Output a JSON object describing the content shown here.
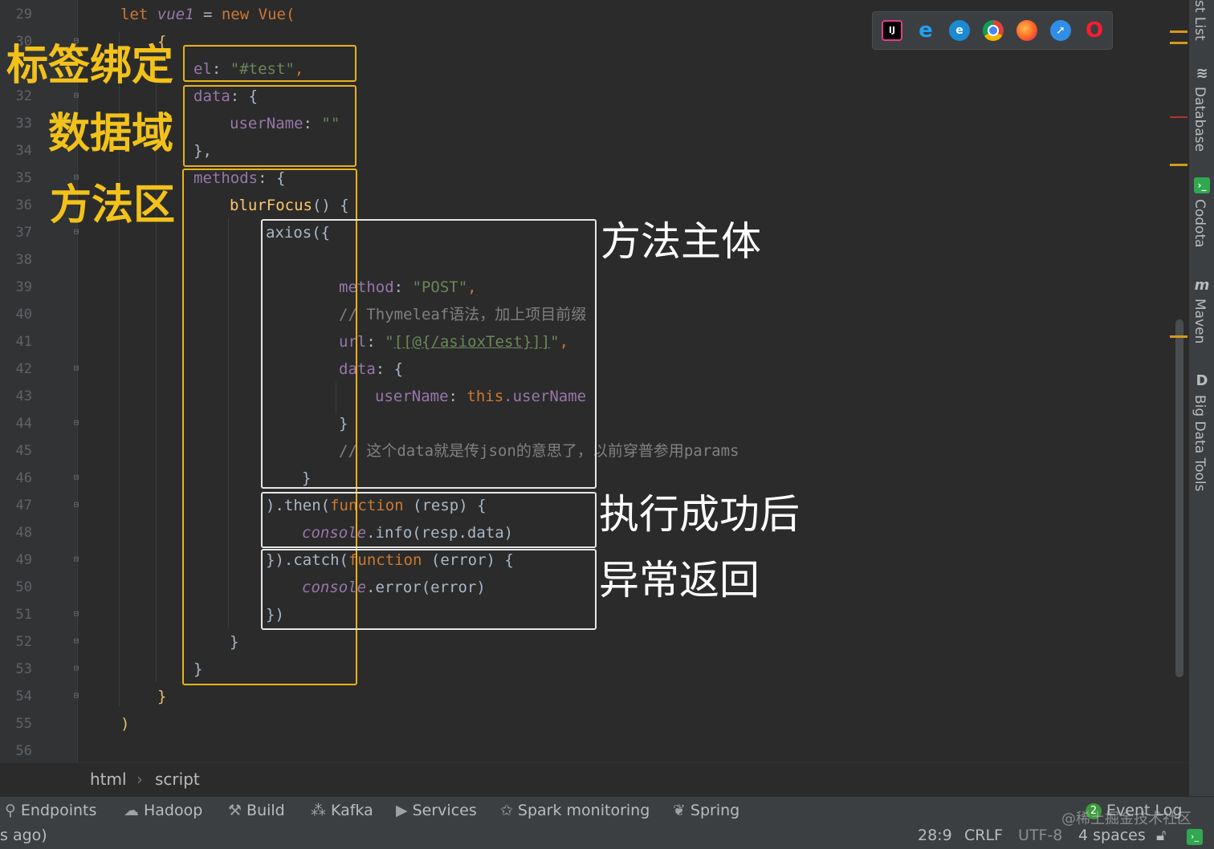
{
  "editor": {
    "line_numbers": [
      "29",
      "30",
      "32",
      "33",
      "34",
      "35",
      "36",
      "37",
      "38",
      "39",
      "40",
      "41",
      "42",
      "43",
      "44",
      "45",
      "46",
      "47",
      "48",
      "49",
      "50",
      "51",
      "52",
      "53",
      "54",
      "55",
      "56"
    ],
    "code": {
      "l29_let": "let ",
      "l29_var": "vue1",
      "l29_rest": " = ",
      "l29_new": "new ",
      "l29_vue": "Vue(",
      "l30_brace": "{",
      "l31_key": "el",
      "l31_colon": ": ",
      "l31_val": "\"#test\"",
      "l31_comma": ",",
      "l32_key": "data",
      "l32_rest": ": {",
      "l33_key": "userName",
      "l33_colon": ": ",
      "l33_val": "\"\"",
      "l34": "},",
      "l35_key": "methods",
      "l35_rest": ": {",
      "l36_fn": "blurFocus",
      "l36_rest": "() {",
      "l37": "axios({",
      "l39_key": "method",
      "l39_colon": ": ",
      "l39_val": "\"POST\"",
      "l39_comma": ",",
      "l40": "// Thymeleaf语法，加上项目前缀",
      "l41_key": "url",
      "l41_colon": ": ",
      "l41_q1": "\"",
      "l41_val": "[[@{/asioxTest}]]",
      "l41_q2": "\"",
      "l41_comma": ",",
      "l42_key": "data",
      "l42_rest": ": {",
      "l43_key": "userName",
      "l43_colon": ": ",
      "l43_this": "this",
      "l43_rest": ".userName",
      "l44": "}",
      "l45": "// 这个data就是传json的意思了，以前穿普参用params",
      "l46": "}",
      "l47_a": ").then(",
      "l47_fn": "function",
      "l47_b": " (resp) {",
      "l48_a": "console",
      "l48_b": ".info(resp.data)",
      "l49_a": "}).catch(",
      "l49_fn": "function",
      "l49_b": " (error) {",
      "l50_a": "console",
      "l50_b": ".error(error)",
      "l51": "})",
      "l52": "}",
      "l53": "}",
      "l54": "}",
      "l55": ")"
    }
  },
  "annotations": {
    "label_binding": "标签绑定",
    "data_domain": "数据域",
    "method_area": "方法区",
    "method_body": "方法主体",
    "on_success": "执行成功后",
    "on_error": "异常返回"
  },
  "browser_icons": [
    "intellij-icon",
    "ie-icon",
    "edge-icon",
    "chrome-icon",
    "firefox-icon",
    "safari-icon",
    "opera-icon"
  ],
  "right_panel": {
    "tabs": [
      "st List",
      "Database",
      "Codota",
      "Maven",
      "Big Data Tools"
    ]
  },
  "breadcrumb": {
    "items": [
      "html",
      "script"
    ],
    "separator": "›"
  },
  "toolbar": {
    "items": [
      "Endpoints",
      "Hadoop",
      "Build",
      "Kafka",
      "Services",
      "Spark monitoring",
      "Spring"
    ],
    "event_log": "Event Log",
    "event_count": "2"
  },
  "status": {
    "left_text": "s ago)",
    "position": "28:9",
    "line_sep": "CRLF",
    "encoding": "UTF-8",
    "indent": "4 spaces",
    "watermark": "@稀土掘金技术社区"
  },
  "colors": {
    "yellow_box": "#e8b21b",
    "white_box": "#e6e6e6",
    "background": "#2b2b2b"
  }
}
